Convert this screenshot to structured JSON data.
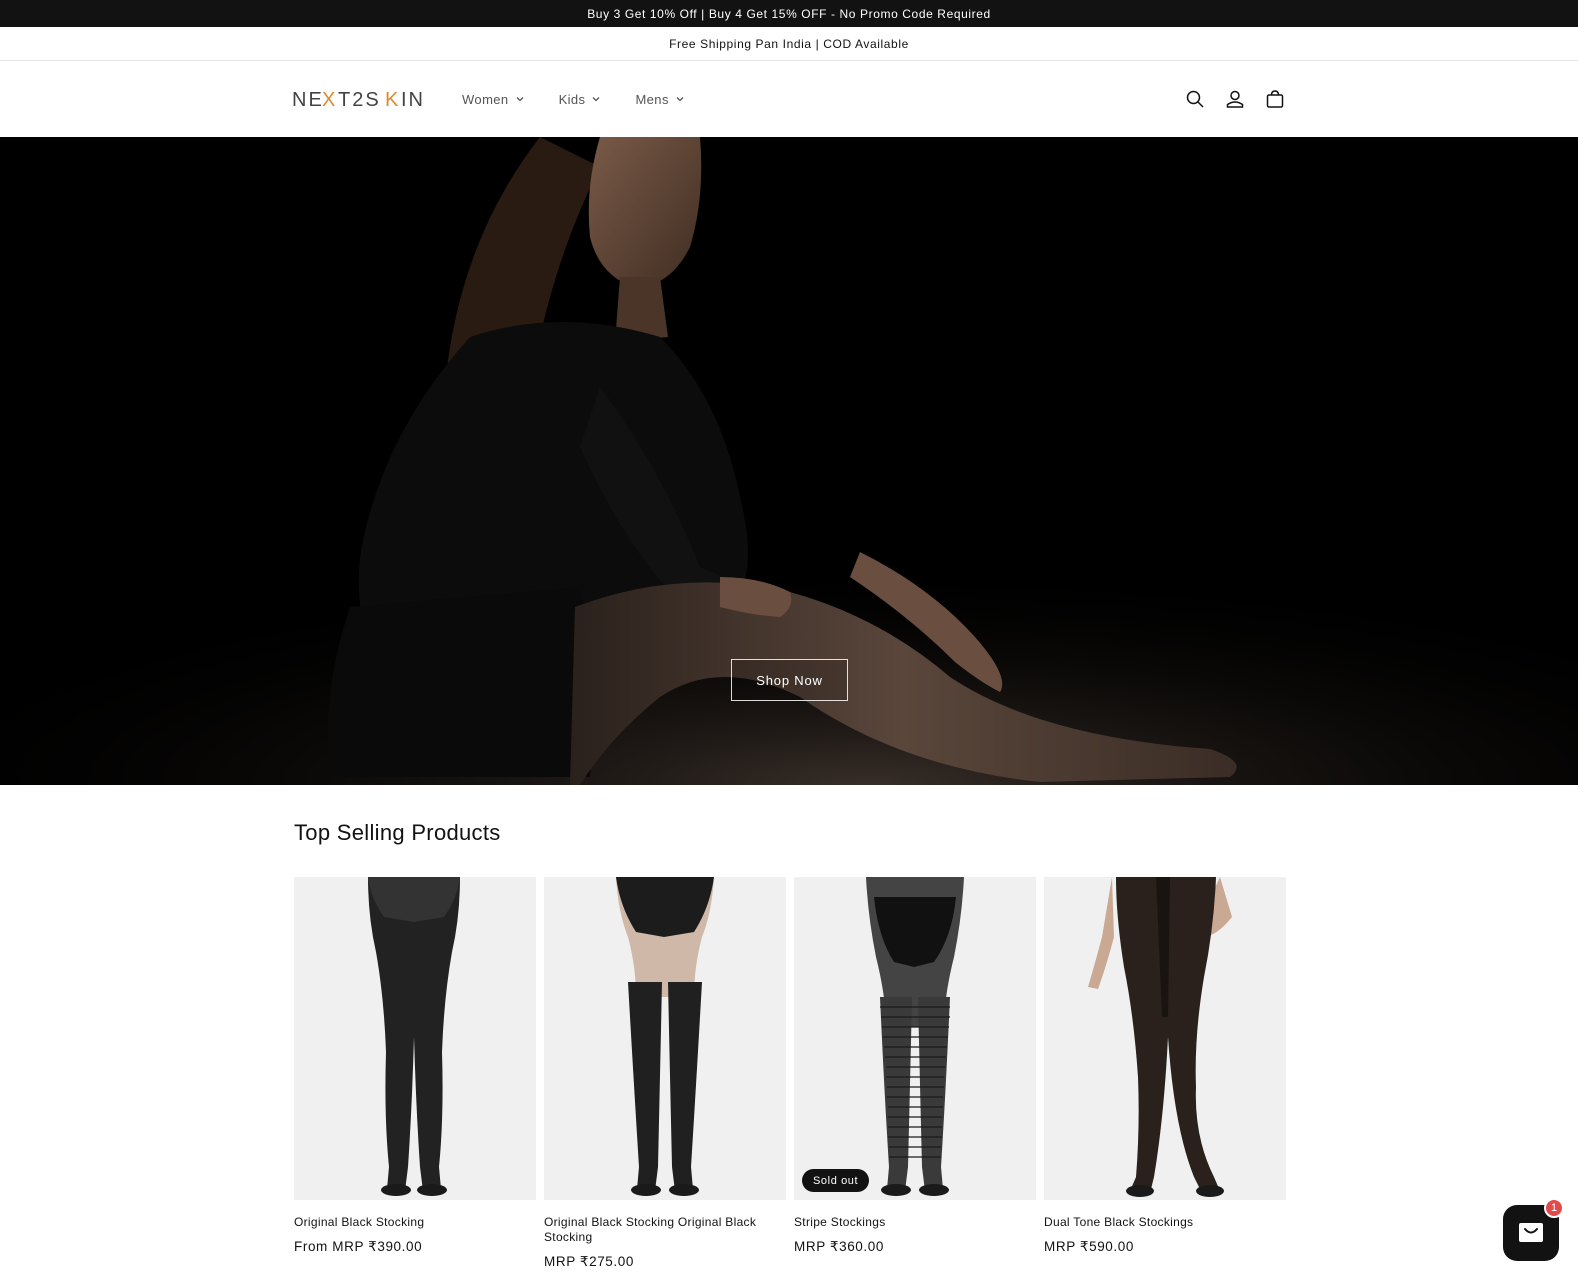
{
  "announcements": {
    "top": "Buy 3 Get 10% Off | Buy 4 Get 15% OFF - No Promo Code Required",
    "second": "Free Shipping Pan India | COD Available"
  },
  "header": {
    "logo_text": "NEXT2SKIN",
    "nav": [
      {
        "label": "Women",
        "icon": "chevron-down-icon"
      },
      {
        "label": "Kids",
        "icon": "chevron-down-icon"
      },
      {
        "label": "Mens",
        "icon": "chevron-down-icon"
      }
    ],
    "icons": [
      "search-icon",
      "account-icon",
      "cart-icon"
    ]
  },
  "hero": {
    "button_label": "Shop Now"
  },
  "products_section": {
    "title": "Top Selling Products",
    "items": [
      {
        "title": "Original Black Stocking",
        "price": "From MRP ₹390.00",
        "badge": ""
      },
      {
        "title": "Original Black Stocking Original Black Stocking",
        "price": "MRP ₹275.00",
        "badge": ""
      },
      {
        "title": "Stripe Stockings",
        "price": "MRP ₹360.00",
        "badge": "Sold out"
      },
      {
        "title": "Dual Tone Black Stockings",
        "price": "MRP ₹590.00",
        "badge": ""
      }
    ]
  },
  "chat": {
    "icon": "chat-icon",
    "unread_count": "1"
  },
  "colors": {
    "announcement_bg": "#121212",
    "card_bg": "#f0f0f0",
    "logo_accent": "#e0892e",
    "chat_badge": "#e34b4b"
  }
}
